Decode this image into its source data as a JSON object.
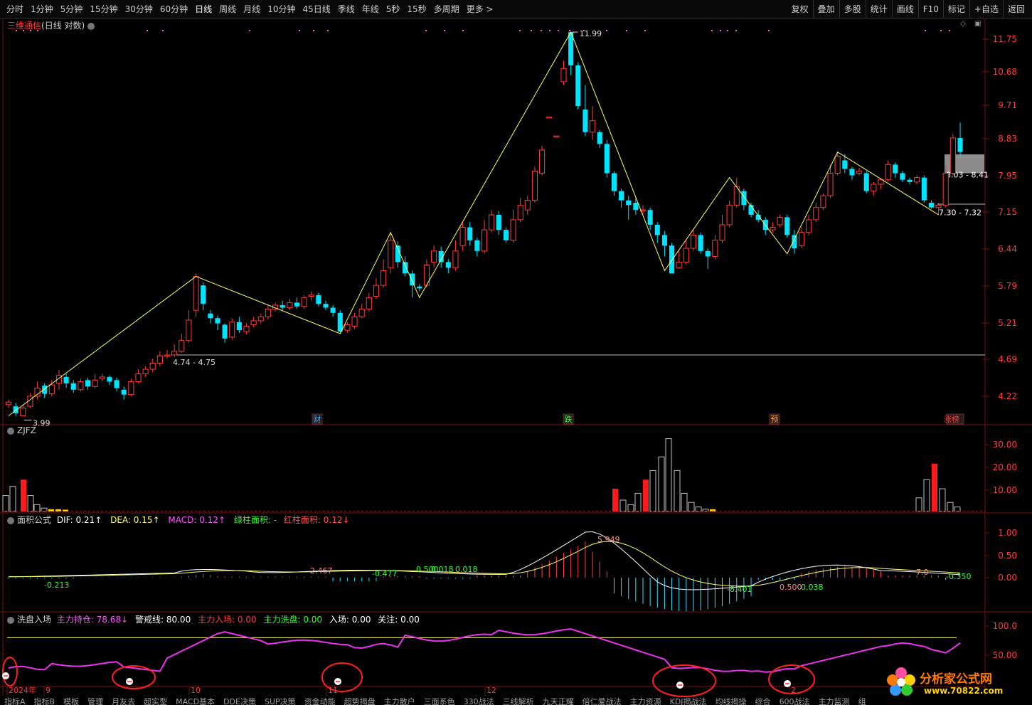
{
  "toolbar": {
    "periods": [
      "分时",
      "1分钟",
      "5分钟",
      "15分钟",
      "30分钟",
      "60分钟",
      "日线",
      "周线",
      "月线",
      "10分钟",
      "45日线",
      "季线",
      "年线",
      "5秒",
      "15秒",
      "多周期",
      "更多 >"
    ],
    "active_period": "日线",
    "right_buttons": [
      "复权",
      "叠加",
      "多股",
      "统计",
      "画线",
      "F10",
      "标记",
      "+自选",
      "返回"
    ]
  },
  "main": {
    "stock_name": "三维通信",
    "mode": "(日线 对数)",
    "y_ticks": [
      "11.75",
      "10.68",
      "9.71",
      "8.83",
      "7.95",
      "7.15",
      "6.44",
      "5.79",
      "5.21",
      "4.69",
      "4.22"
    ],
    "annotations": {
      "high": "11.99",
      "low": "3.99",
      "support_label": "4.74 - 4.75",
      "box_upper": "8.03 - 8.41",
      "box_lower": "7.30 - 7.32"
    },
    "events": [
      "财",
      "跌",
      "预",
      "涨榜"
    ]
  },
  "zjfz": {
    "label": "ZJFZ",
    "y_ticks": [
      "30.00",
      "20.00",
      "10.00"
    ]
  },
  "macd": {
    "title": "面积公式",
    "dif_label": "DIF:",
    "dif_value": "0.21↑",
    "dea_label": "DEA:",
    "dea_value": "0.15↑",
    "macd_label": "MACD:",
    "macd_value": "0.12↑",
    "green_area": "绿柱面积: -",
    "red_area_label": "红柱面积:",
    "red_area_value": "0.12↓",
    "y_ticks": [
      "1.00",
      "0.50",
      "0.00"
    ],
    "labels": [
      "-0.213",
      "2.467",
      "-0.477",
      "0.500",
      "0.018",
      "0.018",
      "5.949",
      "-8.401",
      "0.500",
      "0.038",
      "-0.350",
      "7.0"
    ]
  },
  "wash": {
    "title": "洗盘入场",
    "holding_label": "主力持仓:",
    "holding_value": "78.68↓",
    "warn_label": "警戒线:",
    "warn_value": "80.00",
    "main_in_label": "主力入场:",
    "main_in_value": "0.00",
    "main_wash_label": "主力洗盘:",
    "main_wash_value": "0.00",
    "enter_label": "入场:",
    "enter_value": "0.00",
    "focus_label": "关注:",
    "focus_value": "0.00",
    "y_ticks": [
      "100.0",
      "50.00"
    ]
  },
  "x_axis": {
    "labels": [
      "2024年",
      "9",
      "10",
      "11",
      "12",
      "2"
    ]
  },
  "footer": {
    "tabs": [
      "指标A",
      "指标B",
      "模板",
      "管理",
      "月友去",
      "超实型",
      "MACD基本",
      "DDE决策",
      "SUP决策",
      "资金动能",
      "超势揭盘",
      "主力散户",
      "三面系色",
      "330战法",
      "三线解析",
      "九天正耀",
      "倍仁爱战法",
      "主力资源",
      "KDJ揭战法",
      "均线揭操",
      "综合",
      "600战法",
      "主力监测",
      "组"
    ]
  },
  "watermark": {
    "title": "分析家公式网",
    "url": "www.70822.com"
  },
  "colors": {
    "up": "#ff3b3b",
    "down": "#00e5ff",
    "zig": "#ffff66",
    "border": "#7a1010"
  }
}
